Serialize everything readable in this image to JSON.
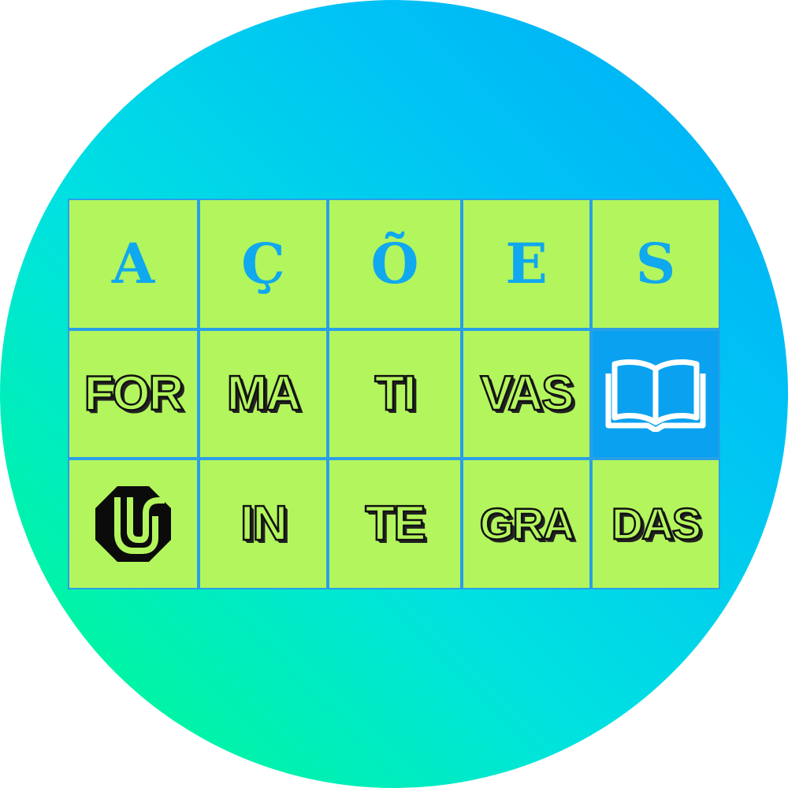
{
  "row1": [
    "A",
    "Ç",
    "Õ",
    "E",
    "S"
  ],
  "row2": [
    "FOR",
    "MA",
    "TI",
    "VAS"
  ],
  "row3": [
    "IN",
    "TE",
    "GRA",
    "DAS"
  ],
  "icons": {
    "book": "open-book-icon",
    "logo": "ufu-logo-icon"
  },
  "colors": {
    "tile": "#b3f55d",
    "tile_border": "#2a9fe6",
    "letter": "#10a8ee",
    "book_tile": "#0aa2f0",
    "outline": "#111111"
  }
}
